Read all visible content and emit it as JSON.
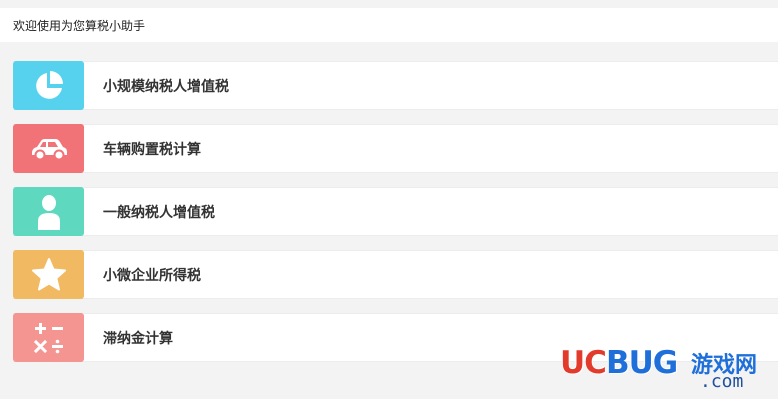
{
  "header": {
    "welcome": "欢迎使用为您算税小助手"
  },
  "items": [
    {
      "label": "小规模纳税人增值税",
      "icon": "pie-chart-icon",
      "color": "#56d2ee"
    },
    {
      "label": "车辆购置税计算",
      "icon": "car-icon",
      "color": "#f27377"
    },
    {
      "label": "一般纳税人增值税",
      "icon": "person-icon",
      "color": "#5fd8c0"
    },
    {
      "label": "小微企业所得税",
      "icon": "star-icon",
      "color": "#f1b961"
    },
    {
      "label": "滞纳金计算",
      "icon": "calculator-icon",
      "color": "#f59591"
    }
  ],
  "watermark": {
    "logo_red": "UC",
    "logo_blue": "BUG",
    "cn": "游戏网",
    "domain": ".com"
  }
}
